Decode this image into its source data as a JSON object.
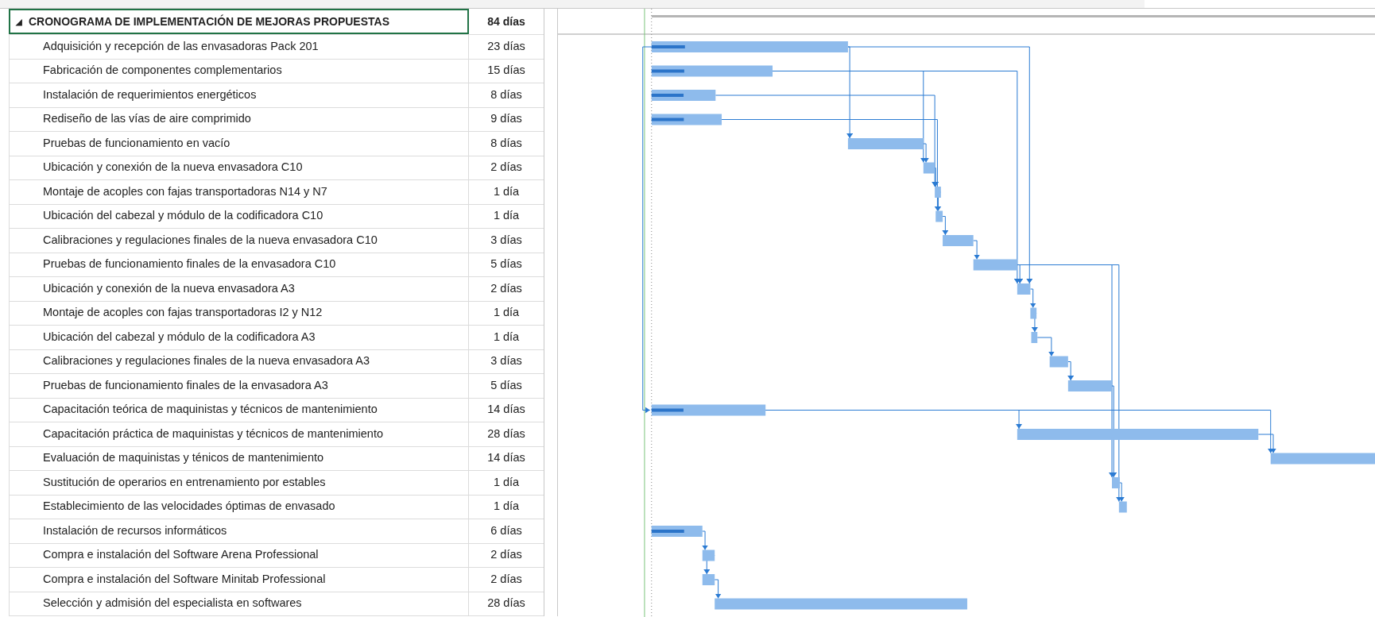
{
  "summary": {
    "toggle": "◢",
    "name": "CRONOGRAMA DE IMPLEMENTACIÓN DE MEJORAS PROPUESTAS",
    "duration": "84 días",
    "selected": true
  },
  "tasks": [
    {
      "name": "Adquisición y recepción de las envasadoras Pack 201",
      "duration": "23 días",
      "level": 0.17
    },
    {
      "name": "Fabricación de componentes complementarios",
      "duration": "15 días",
      "level": 0.27
    },
    {
      "name": "Instalación de requerimientos energéticos",
      "duration": "8 días",
      "level": 0.5
    },
    {
      "name": "Rediseño de las vías de aire comprimido",
      "duration": "9 días",
      "level": 0.46
    },
    {
      "name": "Pruebas de funcionamiento en vacío",
      "duration": "8 días"
    },
    {
      "name": "Ubicación y conexión de la nueva envasadora C10",
      "duration": "2 días"
    },
    {
      "name": "Montaje de acoples con fajas transportadoras N14 y N7",
      "duration": "1 día"
    },
    {
      "name": "Ubicación del cabezal y módulo de la codificadora C10",
      "duration": "1 día"
    },
    {
      "name": "Calibraciones y regulaciones finales de la nueva envasadora C10",
      "duration": "3 días"
    },
    {
      "name": "Pruebas de funcionamiento finales de la envasadora C10",
      "duration": "5 días"
    },
    {
      "name": "Ubicación y conexión de la nueva envasadora A3",
      "duration": "2 días"
    },
    {
      "name": "Montaje de acoples con fajas transportadoras I2 y N12",
      "duration": "1 día"
    },
    {
      "name": "Ubicación del cabezal y módulo de la codificadora A3",
      "duration": "1 día"
    },
    {
      "name": "Calibraciones y regulaciones finales de la nueva envasadora A3",
      "duration": "3 días"
    },
    {
      "name": "Pruebas de funcionamiento finales de la envasadora A3",
      "duration": "5 días"
    },
    {
      "name": "Capacitación teórica de maquinistas y técnicos de mantenimiento",
      "duration": "14 días",
      "level": 0.28
    },
    {
      "name": "Capacitación práctica de maquinistas y técnicos de mantenimiento",
      "duration": "28 días"
    },
    {
      "name": "Evaluación de maquinistas y ténicos de mantenimiento",
      "duration": "14 días"
    },
    {
      "name": "Sustitución de operarios en entrenamiento por estables",
      "duration": "1 día"
    },
    {
      "name": "Establecimiento de las velocidades óptimas de envasado",
      "duration": "1 día"
    },
    {
      "name": "Instalación de recursos informáticos",
      "duration": "6 días",
      "level": 0.64
    },
    {
      "name": "Compra e instalación del Software Arena Professional",
      "duration": "2 días"
    },
    {
      "name": "Compra e instalación del Software Minitab Professional",
      "duration": "2 días"
    },
    {
      "name": "Selección y admisión del especialista en softwares",
      "duration": "28 días"
    }
  ]
}
